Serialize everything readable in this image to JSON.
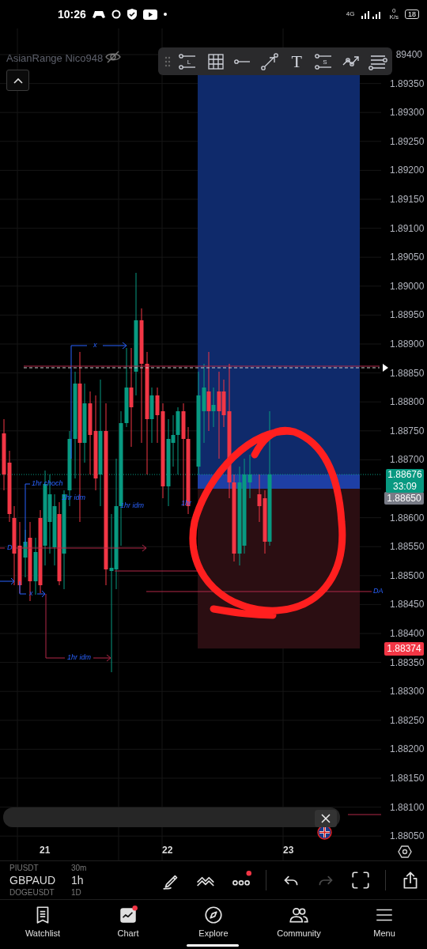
{
  "status_bar": {
    "time": "10:26",
    "network": "4G",
    "speed_value": "0",
    "speed_unit": "K/s",
    "battery": "18"
  },
  "chart": {
    "indicator_label": "AsianRange Nico948",
    "drawing_tools": [
      {
        "kind": "long",
        "letter": "L"
      },
      {
        "kind": "grid"
      },
      {
        "kind": "line"
      },
      {
        "kind": "arrow"
      },
      {
        "kind": "text",
        "glyph": "T"
      },
      {
        "kind": "short",
        "letter": "S"
      },
      {
        "kind": "path"
      },
      {
        "kind": "lines"
      }
    ],
    "price_axis": [
      {
        "label": "89400",
        "kind": "tick"
      },
      {
        "label": "1.89350",
        "kind": "tick"
      },
      {
        "label": "1.89300",
        "kind": "tick"
      },
      {
        "label": "1.89250",
        "kind": "tick"
      },
      {
        "label": "1.89200",
        "kind": "tick"
      },
      {
        "label": "1.89150",
        "kind": "tick"
      },
      {
        "label": "1.89100",
        "kind": "tick"
      },
      {
        "label": "1.89050",
        "kind": "tick"
      },
      {
        "label": "1.89000",
        "kind": "tick"
      },
      {
        "label": "1.88950",
        "kind": "tick"
      },
      {
        "label": "1.88900",
        "kind": "tick"
      },
      {
        "label": "1.88850",
        "kind": "tick"
      },
      {
        "label": "1.88800",
        "kind": "tick"
      },
      {
        "label": "1.88750",
        "kind": "tick"
      },
      {
        "label": "1.88700",
        "kind": "tick"
      },
      {
        "label": "1.88650",
        "kind": "tag"
      },
      {
        "label": "1.88600",
        "kind": "tick"
      },
      {
        "label": "1.88550",
        "kind": "tick"
      },
      {
        "label": "1.88500",
        "kind": "tick"
      },
      {
        "label": "1.88450",
        "kind": "tick"
      },
      {
        "label": "1.88400",
        "kind": "tick"
      },
      {
        "label": "1.88350",
        "kind": "tick"
      },
      {
        "label": "1.88300",
        "kind": "tick"
      },
      {
        "label": "1.88250",
        "kind": "tick"
      },
      {
        "label": "1.88200",
        "kind": "tick"
      },
      {
        "label": "1.88150",
        "kind": "tick"
      },
      {
        "label": "1.88100",
        "kind": "tick"
      },
      {
        "label": "1.88050",
        "kind": "tick"
      }
    ],
    "last_price": {
      "price": "1.88676",
      "countdown": "33:09"
    },
    "stop_price": "1.88374",
    "annotations": [
      "x",
      "1hr choch",
      "1hr idm",
      "1hr",
      "1hr idm",
      "D",
      "DA",
      "x",
      "1hr idm"
    ],
    "dates": [
      "21",
      "22",
      "23"
    ]
  },
  "symbols": [
    {
      "symbol": "PIUSDT",
      "interval": "30m",
      "selected": false
    },
    {
      "symbol": "GBPAUD",
      "interval": "1h",
      "selected": true
    },
    {
      "symbol": "DOGEUSDT",
      "interval": "1D",
      "selected": false
    }
  ],
  "bottom_tools": [
    {
      "kind": "draw",
      "disabled": false,
      "notification": false
    },
    {
      "kind": "pattern",
      "disabled": false,
      "notification": false
    },
    {
      "kind": "more",
      "disabled": false,
      "notification": true
    },
    {
      "kind": "undo",
      "disabled": false,
      "notification": false
    },
    {
      "kind": "redo",
      "disabled": true,
      "notification": false
    },
    {
      "kind": "fullscreen",
      "disabled": false,
      "notification": false
    },
    {
      "kind": "share",
      "disabled": false,
      "notification": false
    }
  ],
  "nav": [
    {
      "label": "Watchlist",
      "kind": "watchlist",
      "notification": false
    },
    {
      "label": "Chart",
      "kind": "chart",
      "notification": true
    },
    {
      "label": "Explore",
      "kind": "explore",
      "notification": false
    },
    {
      "label": "Community",
      "kind": "community",
      "notification": false
    },
    {
      "label": "Menu",
      "kind": "menu",
      "notification": false
    }
  ]
}
